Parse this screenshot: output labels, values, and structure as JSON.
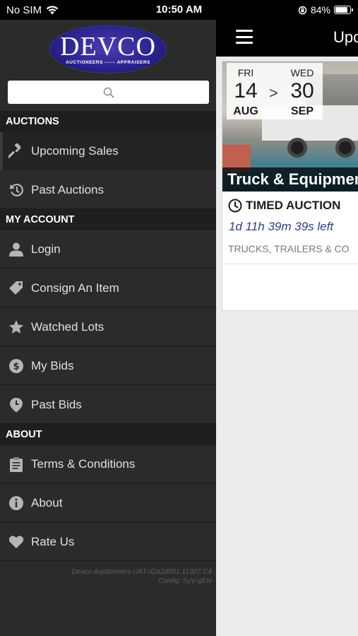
{
  "status_bar": {
    "carrier": "No SIM",
    "time": "10:50 AM",
    "battery": "84%",
    "battery_level": 0.84
  },
  "drawer": {
    "logo": {
      "title": "DEVCO",
      "subtitle": "AUCTIONEERS ─── APPRAISERS"
    },
    "search": {
      "placeholder": ""
    },
    "sections": {
      "auctions": "AUCTIONS",
      "my_account": "MY ACCOUNT",
      "about": "ABOUT"
    },
    "items": {
      "upcoming_sales": "Upcoming Sales",
      "past_auctions": "Past Auctions",
      "login": "Login",
      "consign": "Consign An Item",
      "watched_lots": "Watched Lots",
      "my_bids": "My Bids",
      "past_bids": "Past Bids",
      "terms": "Terms & Conditions",
      "about": "About",
      "rate_us": "Rate Us"
    },
    "version_line1": "Devco Auctioneers-UAT-d2a2d991.11307.C4",
    "version_line2": "Config: SyV-gEIv"
  },
  "main": {
    "title": "Upcoming Sales",
    "card": {
      "start_day": "FRI",
      "start_date": "14",
      "start_month": "AUG",
      "arrow": ">",
      "end_day": "WED",
      "end_date": "30",
      "end_month": "SEP",
      "title": "Truck & Equipment",
      "type": "TIMED AUCTION",
      "countdown": "1d 11h 39m 39s left",
      "categories": "TRUCKS, TRAILERS & CO"
    }
  },
  "colors": {
    "drawer_bg": "#2b2b2b",
    "section_header_bg": "#1f1f1f",
    "countdown": "#2d3a8c",
    "logo_blue": "#2c2490"
  }
}
